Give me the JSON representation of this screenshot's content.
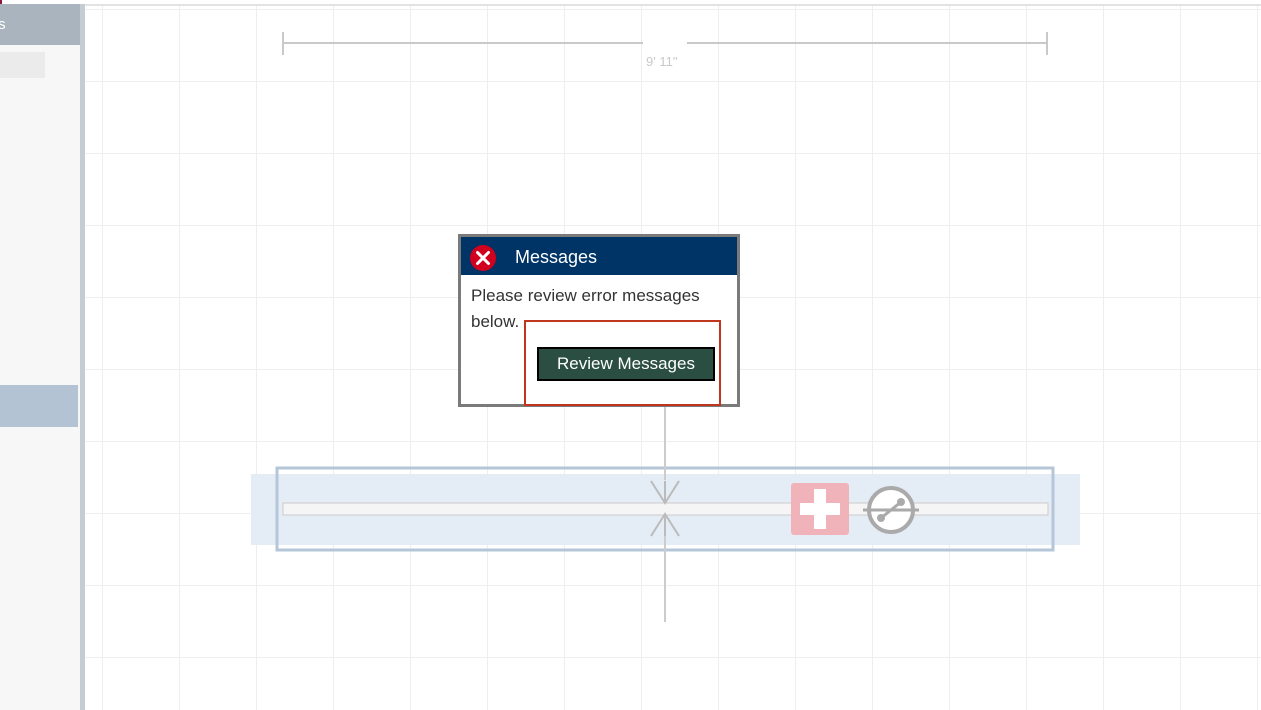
{
  "sidebar": {
    "header_label": "ts"
  },
  "canvas": {
    "dimension_label": "9' 11\""
  },
  "dialog": {
    "title": "Messages",
    "body": "Please review error messages below.",
    "review_button_label": "Review Messages",
    "icon": "error-circle-x-icon"
  },
  "shelf": {
    "add_icon": "plus-icon",
    "connector_icon": "conduit-connector-icon"
  },
  "colors": {
    "dialog_header": "#003366",
    "button": "#2a4f42",
    "highlight": "#c0361c",
    "error_icon": "#d1001f",
    "add_icon_bg": "#f1b3ba"
  }
}
